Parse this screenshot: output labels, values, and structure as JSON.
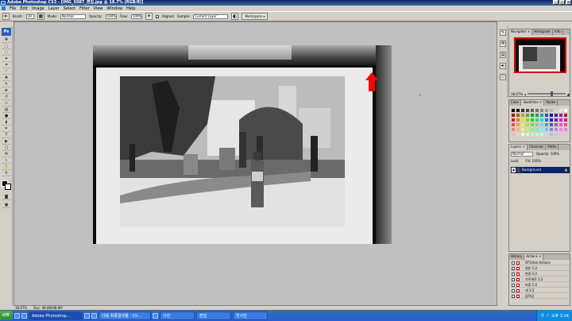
{
  "titlebar": {
    "title": "Adobe Photoshop CS3 - [IMG_5087_편집.jpg @ 18.7% (RGB/8)]"
  },
  "menu": [
    "File",
    "Edit",
    "Image",
    "Layer",
    "Select",
    "Filter",
    "View",
    "Window",
    "Help"
  ],
  "options": {
    "brush_label": "Brush:",
    "brush_size": "30",
    "mode_label": "Mode:",
    "mode_value": "Normal",
    "opacity_label": "Opacity:",
    "opacity_value": "100%",
    "flow_label": "Flow:",
    "flow_value": "100%",
    "aligned_label": "Aligned",
    "sample_label": "Sample:",
    "sample_value": "Current Layer",
    "workspace_label": "Workspace ▾"
  },
  "navigator": {
    "tabs": [
      "Navigator ×",
      "Histogram",
      "Info"
    ],
    "zoom": "18.67%"
  },
  "color": {
    "tabs": [
      "Color",
      "Swatches ×",
      "Styles"
    ]
  },
  "layers": {
    "tabs": [
      "Layers ×",
      "Channels",
      "Paths"
    ],
    "mode": "Normal",
    "opacity": "Opacity: 100%",
    "lock": "Lock:",
    "fill": "Fill: 100%",
    "layer_name": "Background"
  },
  "actions": {
    "tabs": [
      "History",
      "Actions ×"
    ],
    "items": [
      "STVchoi Actions",
      "원본 1:2",
      "변경 1:2",
      "가로세로 1:2",
      "보정 1:2",
      "대 1:2",
      "움직임"
    ]
  },
  "status": {
    "zoom": "18.67%",
    "doc": "Doc: 48.8M/48.8M"
  },
  "taskbar": {
    "start": "시작",
    "tasks": [
      "Adobe Photoshop...",
      "다음 최종결과물 - Ch...",
      "사진",
      "편집",
      "연사진"
    ],
    "tray": "오후 3:14"
  },
  "colors": {
    "accent": "#0a246a",
    "arrow": "#ff0000"
  }
}
